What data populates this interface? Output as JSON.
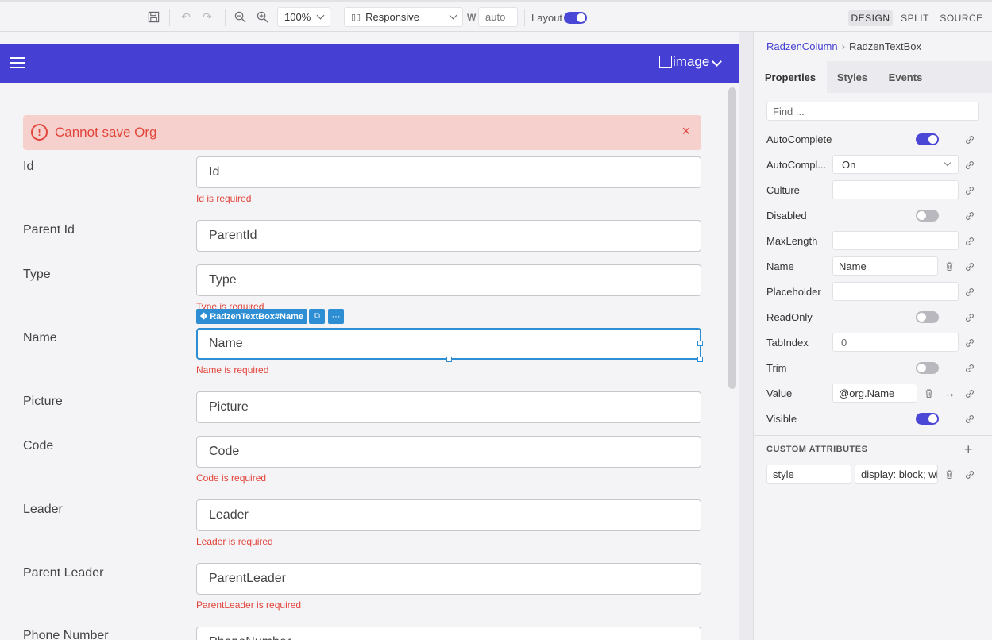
{
  "toolbar": {
    "zoom": "100%",
    "device": "Responsive",
    "width_label": "W",
    "width_value": "auto",
    "layout_label": "Layout",
    "layout_on": true,
    "modes": [
      "DESIGN",
      "SPLIT",
      "SOURCE"
    ],
    "active_mode": "DESIGN"
  },
  "app_header": {
    "image_alt": "image"
  },
  "alert": {
    "message": "Cannot save Org",
    "close": "×"
  },
  "form": {
    "fields": [
      {
        "label": "Id",
        "value": "Id",
        "error": "Id is required"
      },
      {
        "label": "Parent Id",
        "value": "ParentId",
        "error": ""
      },
      {
        "label": "Type",
        "value": "Type",
        "error": "Type is required"
      },
      {
        "label": "Name",
        "value": "Name",
        "error": "Name is required"
      },
      {
        "label": "Picture",
        "value": "Picture",
        "error": ""
      },
      {
        "label": "Code",
        "value": "Code",
        "error": "Code is required"
      },
      {
        "label": "Leader",
        "value": "Leader",
        "error": "Leader is required"
      },
      {
        "label": "Parent Leader",
        "value": "ParentLeader",
        "error": "ParentLeader is required"
      },
      {
        "label": "Phone Number",
        "value": "PhoneNumber",
        "error": ""
      }
    ],
    "selection_tag": "RadzenTextBox#Name",
    "selection_more": "···"
  },
  "panel": {
    "breadcrumb": [
      "RadzenColumn",
      "RadzenTextBox"
    ],
    "tabs": [
      "Properties",
      "Styles",
      "Events"
    ],
    "active_tab": "Properties",
    "find_placeholder": "Find ...",
    "properties": [
      {
        "label": "AutoComplete",
        "type": "toggle",
        "on": true
      },
      {
        "label": "AutoCompl...",
        "type": "select",
        "value": "On"
      },
      {
        "label": "Culture",
        "type": "input",
        "value": ""
      },
      {
        "label": "Disabled",
        "type": "toggle",
        "on": false
      },
      {
        "label": "MaxLength",
        "type": "input",
        "value": ""
      },
      {
        "label": "Name",
        "type": "input",
        "value": "Name"
      },
      {
        "label": "Placeholder",
        "type": "input",
        "value": ""
      },
      {
        "label": "ReadOnly",
        "type": "toggle",
        "on": false
      },
      {
        "label": "TabIndex",
        "type": "input",
        "value": "0"
      },
      {
        "label": "Trim",
        "type": "toggle",
        "on": false
      },
      {
        "label": "Value",
        "type": "input",
        "value": "@org.Name"
      },
      {
        "label": "Visible",
        "type": "toggle",
        "on": true
      }
    ],
    "custom_attributes_title": "CUSTOM ATTRIBUTES",
    "custom_attributes": [
      {
        "name": "style",
        "value": "display: block; wi"
      }
    ]
  },
  "colors": {
    "accent": "#4540d3",
    "selection": "#2d8ed3",
    "error": "#e2453c",
    "alert_bg": "#f6d0cc"
  }
}
